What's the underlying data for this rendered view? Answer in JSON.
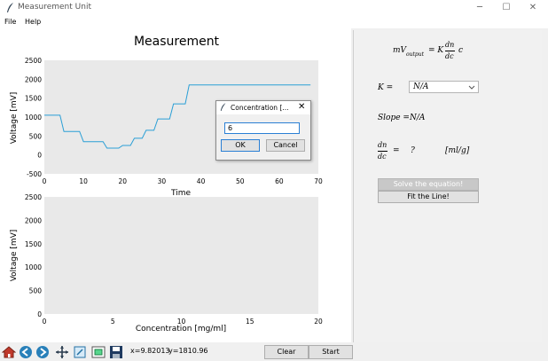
{
  "window": {
    "title": "Measurement Unit"
  },
  "menu": {
    "file": "File",
    "help": "Help"
  },
  "plot1": {
    "title": "Measurement",
    "xlabel": "Time",
    "ylabel": "Voltage [mV]",
    "yticks": [
      "2500",
      "2000",
      "1500",
      "1000",
      "500",
      "0",
      "-500"
    ],
    "xticks": [
      "0",
      "10",
      "20",
      "30",
      "40",
      "50",
      "60",
      "70"
    ],
    "line_color": "#2a9fd6"
  },
  "plot2": {
    "xlabel": "Concentration [mg/ml]",
    "ylabel": "Voltage [mV]",
    "yticks": [
      "2500",
      "2000",
      "1500",
      "1000",
      "500",
      "0"
    ],
    "xticks": [
      "0",
      "5",
      "10",
      "15",
      "20"
    ]
  },
  "chart_data": {
    "type": "line",
    "title": "Measurement",
    "xlabel": "Time",
    "ylabel": "Voltage [mV]",
    "xlim": [
      0,
      70
    ],
    "ylim": [
      -500,
      2500
    ],
    "grid": false,
    "x": [
      0,
      4,
      5,
      9,
      10,
      15,
      16,
      19,
      20,
      22,
      23,
      25,
      26,
      28,
      29,
      32,
      33,
      36,
      37,
      68
    ],
    "values": [
      1050,
      1050,
      620,
      620,
      350,
      350,
      180,
      180,
      250,
      250,
      440,
      440,
      650,
      650,
      950,
      950,
      1350,
      1350,
      1850,
      1850
    ]
  },
  "status": {
    "x_readout": "x=9.82013",
    "y_readout": "y=1810.96"
  },
  "buttons": {
    "clear": "Clear",
    "start": "Start"
  },
  "dialog": {
    "title": "Concentration [...",
    "value": "6",
    "ok": "OK",
    "cancel": "Cancel"
  },
  "right": {
    "eq_lhs": "mV",
    "eq_sub": "output",
    "eq_rhs_k": "= K",
    "eq_dn": "dn",
    "eq_dc": "dc",
    "eq_c": "c",
    "k_label": "K =",
    "k_value": "N/A",
    "slope_label": "Slope =",
    "slope_value": "N/A",
    "dn": "dn",
    "dc": "dc",
    "eq_sign": "=",
    "q": "?",
    "unit": "[ml/g]",
    "solve_button": "Solve the equation!",
    "fit_button": "Fit the Line!"
  }
}
